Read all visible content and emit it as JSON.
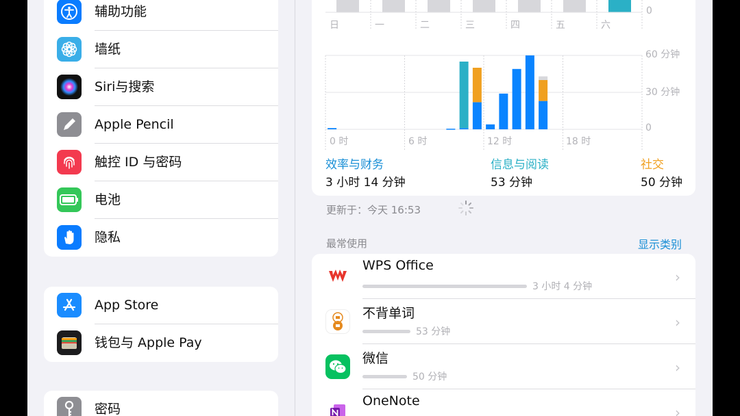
{
  "sidebar": {
    "items": [
      {
        "label": "辅助功能"
      },
      {
        "label": "墙纸"
      },
      {
        "label": "Siri与搜索"
      },
      {
        "label": "Apple Pencil"
      },
      {
        "label": "触控 ID 与密码"
      },
      {
        "label": "电池"
      },
      {
        "label": "隐私"
      },
      {
        "label": "App Store"
      },
      {
        "label": "钱包与 Apple Pay"
      },
      {
        "label": "密码"
      }
    ]
  },
  "weekly": {
    "days": [
      "日",
      "一",
      "二",
      "三",
      "四",
      "五",
      "六"
    ],
    "zero_label": "0"
  },
  "hourly": {
    "y_labels": [
      "60 分钟",
      "30 分钟",
      "0"
    ],
    "x_labels": [
      "0 时",
      "6 时",
      "12 时",
      "18 时"
    ]
  },
  "categories": [
    {
      "name": "效率与财务",
      "value": "3 小时 14 分钟",
      "color": "#1a8fd6"
    },
    {
      "name": "信息与阅读",
      "value": "53 分钟",
      "color": "#2bb0c6"
    },
    {
      "name": "社交",
      "value": "50 分钟",
      "color": "#f0a020"
    }
  ],
  "updated": {
    "label": "更新于：今天 16:53"
  },
  "most_used": {
    "title": "最常使用",
    "show_categories": "显示类别",
    "apps": [
      {
        "name": "WPS Office",
        "time": "3 小时 4 分钟",
        "fraction": 1.0
      },
      {
        "name": "不背单词",
        "time": "53 分钟",
        "fraction": 0.29
      },
      {
        "name": "微信",
        "time": "50 分钟",
        "fraction": 0.27
      },
      {
        "name": "OneNote",
        "time": ""
      }
    ]
  },
  "chart_data": {
    "type": "bar",
    "x": [
      "0",
      "1",
      "2",
      "3",
      "4",
      "5",
      "6",
      "7",
      "8",
      "9",
      "10",
      "11",
      "12",
      "13",
      "14",
      "15",
      "16",
      "17",
      "18",
      "19",
      "20",
      "21",
      "22",
      "23"
    ],
    "series": [
      {
        "name": "效率与财务",
        "color": "#0a84ff",
        "values": [
          1,
          0,
          0,
          0,
          0,
          0,
          0,
          0,
          0,
          0.5,
          1,
          22,
          4,
          29,
          49,
          60,
          23,
          0,
          0,
          0,
          0,
          0,
          0,
          0
        ]
      },
      {
        "name": "信息与阅读",
        "color": "#2bb0c6",
        "values": [
          0,
          0,
          0,
          0,
          0,
          0,
          0,
          0,
          0,
          0,
          54,
          0,
          0,
          0,
          0,
          0,
          0,
          0,
          0,
          0,
          0,
          0,
          0,
          0
        ]
      },
      {
        "name": "社交",
        "color": "#f0a020",
        "values": [
          0,
          0,
          0,
          0,
          0,
          0,
          0,
          0,
          0,
          0,
          0,
          28,
          0,
          0,
          0,
          0,
          17,
          0,
          0,
          0,
          0,
          0,
          0,
          0
        ]
      },
      {
        "name": "",
        "color": "#d8d8dc",
        "values": [
          0,
          0,
          0,
          0,
          0,
          0,
          0,
          0,
          0,
          0,
          0,
          0,
          0,
          0,
          0,
          0,
          3,
          0,
          0,
          0,
          0,
          0,
          0,
          0
        ]
      }
    ],
    "ylim": [
      0,
      60
    ],
    "y_tick_labels": [
      "60 分钟",
      "30 分钟",
      "0"
    ],
    "x_tick_labels": [
      "0 时",
      "6 时",
      "12 时",
      "18 时"
    ]
  }
}
